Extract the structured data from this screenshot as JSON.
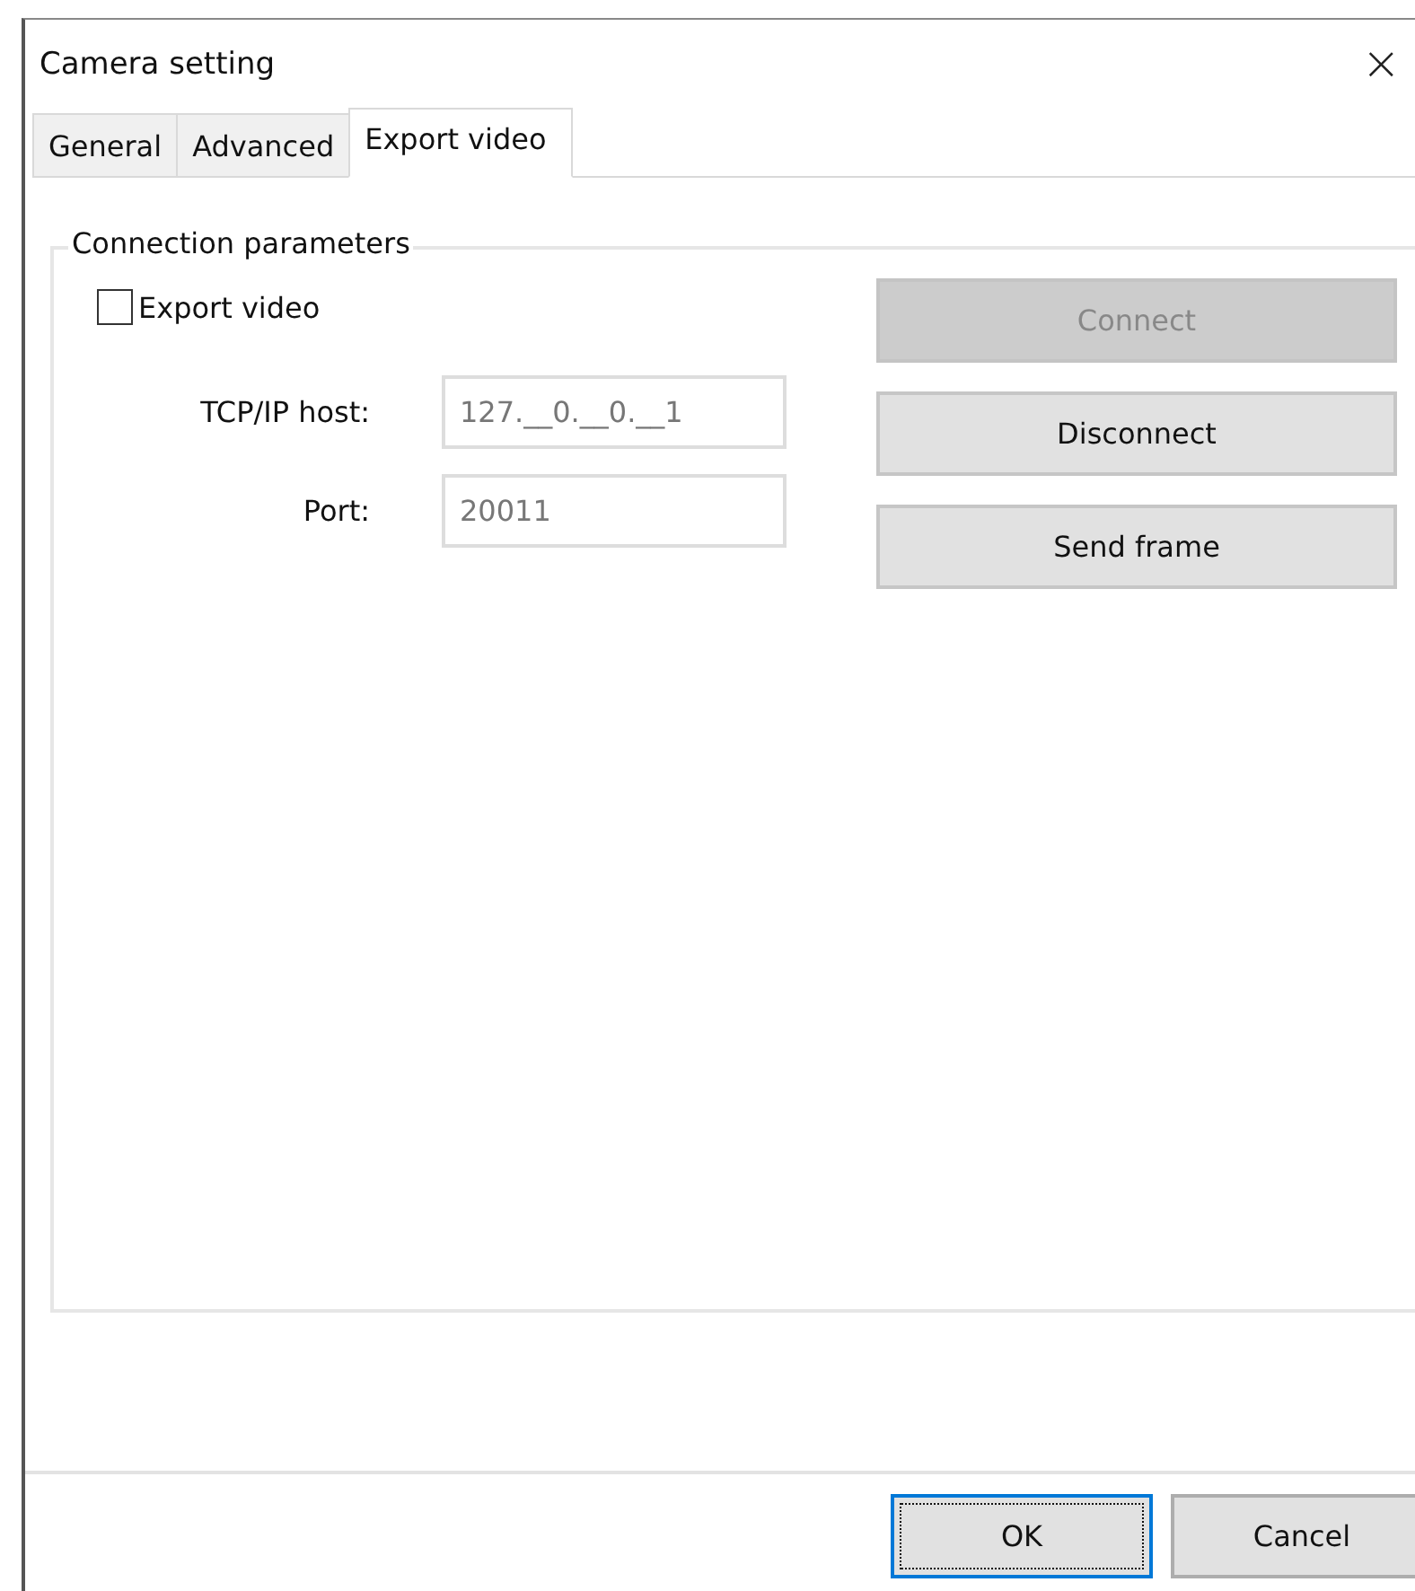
{
  "window": {
    "title": "Camera setting",
    "close": "×"
  },
  "tabs": [
    {
      "label": "General",
      "selected": false
    },
    {
      "label": "Advanced",
      "selected": false
    },
    {
      "label": "Export video",
      "selected": true
    }
  ],
  "group": {
    "title": "Connection parameters",
    "checkbox": {
      "label": "Export video",
      "checked": false
    },
    "fields": [
      {
        "label": "TCP/IP host:",
        "value": "127.__0.__0.__1",
        "disabled": true
      },
      {
        "label": "Port:",
        "value": "20011",
        "disabled": true
      }
    ],
    "buttons": [
      {
        "label": "Connect",
        "disabled": true
      },
      {
        "label": "Disconnect",
        "disabled": false
      },
      {
        "label": "Send frame",
        "disabled": false
      }
    ]
  },
  "footer_buttons": [
    {
      "label": "OK",
      "focused": true
    },
    {
      "label": "Cancel",
      "focused": false
    }
  ]
}
